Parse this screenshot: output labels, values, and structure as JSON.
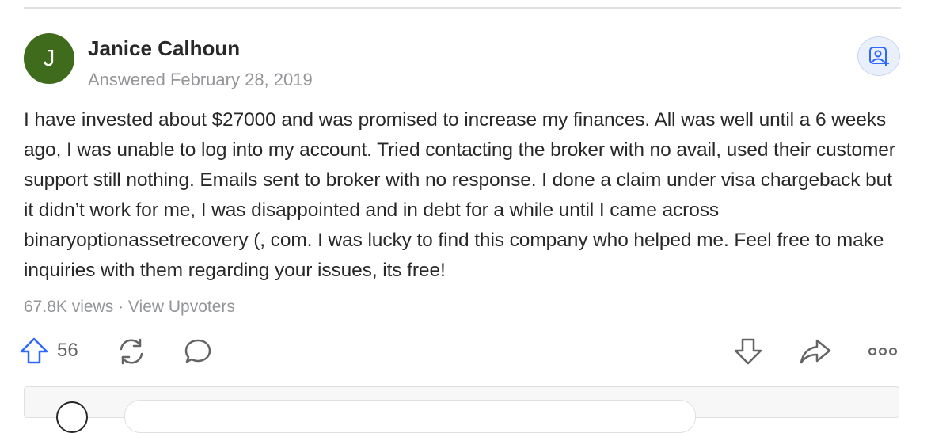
{
  "author": {
    "initial": "J",
    "name": "Janice Calhoun",
    "answered": "Answered February 28, 2019",
    "avatar_color": "#3f6b1c"
  },
  "answer": {
    "text": "I have invested about $27000 and was promised to increase my finances. All was well until a 6 weeks ago, I was unable to log into my account. Tried contacting the broker with no avail, used their customer support still nothing. Emails sent to broker with no response. I done a claim under visa chargeback but it didn’t work for me, I was disappointed and in debt for a while until I came across binaryoptionassetrecovery (, com. I was lucky to find this company who helped me. Feel free to make inquiries with them regarding your issues, its free!"
  },
  "stats": {
    "views": "67.8K views",
    "separator": " · ",
    "upvoters_link": "View Upvoters"
  },
  "actions": {
    "upvote_count": "56",
    "icons": [
      "upvote-icon",
      "share-reshare-icon",
      "comment-icon",
      "downvote-icon",
      "share-icon",
      "more-icon"
    ]
  },
  "colors": {
    "accent": "#2e69ff",
    "text": "#282829",
    "muted": "#939598",
    "icon": "#636466"
  }
}
